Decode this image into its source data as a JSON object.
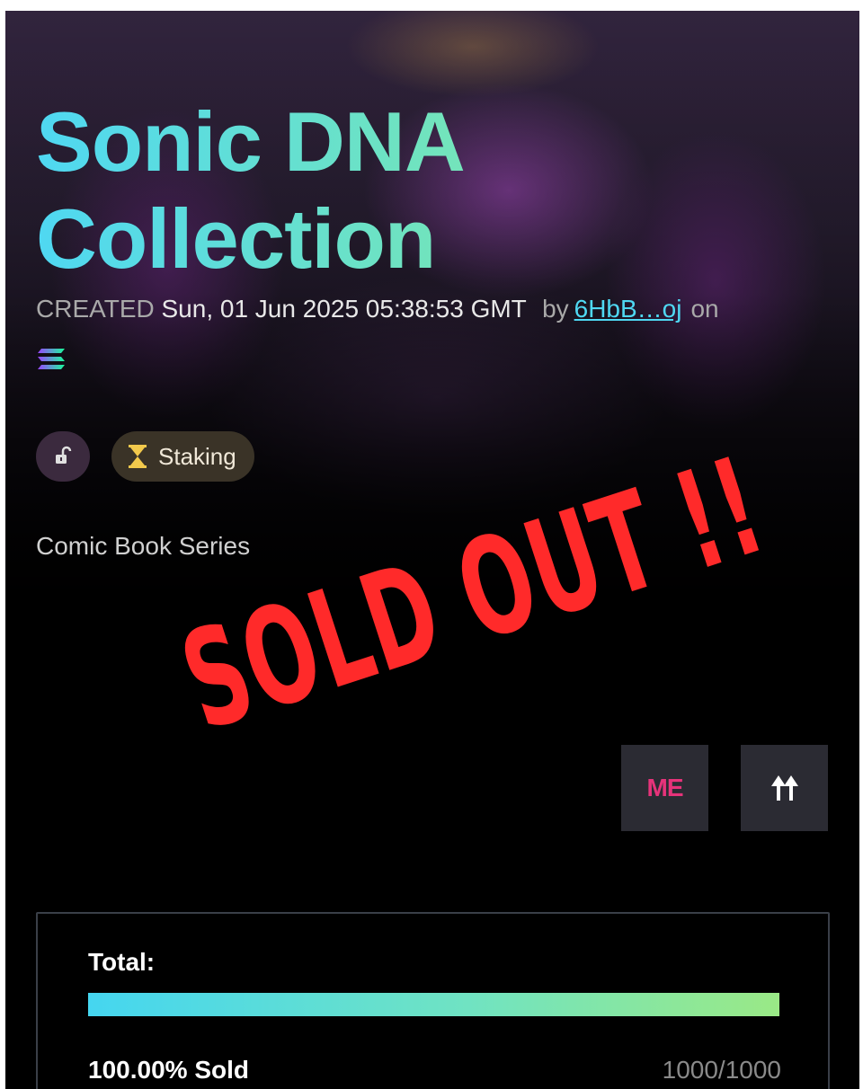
{
  "collection": {
    "title_line1": "Sonic DNA",
    "title_line2": "Collection",
    "created_label": "CREATED",
    "created_date": "Sun, 01 Jun 2025 05:38:53 GMT",
    "by_label": "by",
    "creator": "6HbB…oj",
    "on_label": "on",
    "chain_icon": "solana-logo-icon",
    "description": "Comic Book Series"
  },
  "badges": {
    "lock_icon": "unlock-icon",
    "staking_icon": "hourglass-icon",
    "staking_label": "Staking"
  },
  "overlay": {
    "sold_out_text": "SOLD OUT !!"
  },
  "actions": {
    "magic_eden_label": "ME",
    "magic_eden_icon": "magic-eden-icon",
    "share_icon": "arrows-up-icon"
  },
  "supply": {
    "total_label": "Total:",
    "sold_percent_text": "100.00% Sold",
    "sold_fraction": 1.0,
    "count_text": "1000/1000"
  },
  "colors": {
    "accent_cyan": "#4fd8f2",
    "accent_green": "#8ee8a0",
    "sold_out_red": "#ff2a2a",
    "magic_eden_pink": "#e6337a",
    "staking_gold": "#f2c94c"
  }
}
